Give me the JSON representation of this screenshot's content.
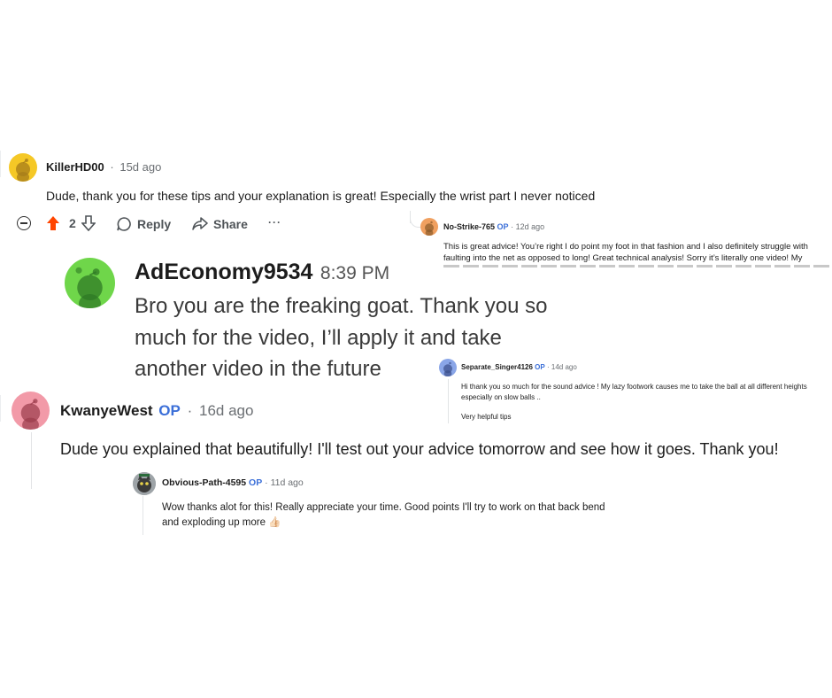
{
  "comment1": {
    "username": "KillerHD00",
    "separator": "·",
    "time": "15d ago",
    "text": "Dude, thank you for these tips and your explanation is great! Especially the wrist part I never noticed",
    "votes": "2",
    "reply_label": "Reply",
    "share_label": "Share",
    "more_label": "···",
    "avatar_color": "#f5c826"
  },
  "comment2": {
    "username": "No-Strike-765",
    "op": "OP",
    "separator": "·",
    "time": "12d ago",
    "text": "This is great advice! You’re right I do point my foot in that fashion and I also definitely struggle with faulting into the net as opposed to long! Great technical analysis! Sorry it’s literally one video! My",
    "avatar_color": "#f0a060"
  },
  "comment3": {
    "username": "AdEconomy9534",
    "time": "8:39 PM",
    "line1": "Bro you are the freaking goat. Thank you so",
    "line2": "much for the video, I’ll apply it and take",
    "line3": "another video in the future",
    "avatar_color": "#6fd64a"
  },
  "comment4": {
    "username": "Separate_Singer4126",
    "op": "OP",
    "separator": "·",
    "time": "14d ago",
    "text": "Hi thank you so much for the sound advice ! My lazy footwork causes me to take the ball at all different heights especially on slow balls ..",
    "text2": "Very helpful tips",
    "avatar_color": "#8aa6e8"
  },
  "comment5": {
    "username": "KwanyeWest",
    "op": "OP",
    "separator": "·",
    "time": "16d ago",
    "text": "Dude you explained that beautifully! I'll test out your advice tomorrow and see how it goes. Thank you!",
    "avatar_color": "#f29aa8"
  },
  "comment6": {
    "username": "Obvious-Path-4595",
    "op": "OP",
    "separator": "·",
    "time": "11d ago",
    "line1": "Wow thanks alot for this! Really appreciate your time. Good points I'll try to work on that back bend",
    "line2": "and exploding up more 👍🏻"
  },
  "colors": {
    "upvote": "#ff4500",
    "op_blue": "#3b6fd8",
    "muted": "#6b6f73"
  }
}
